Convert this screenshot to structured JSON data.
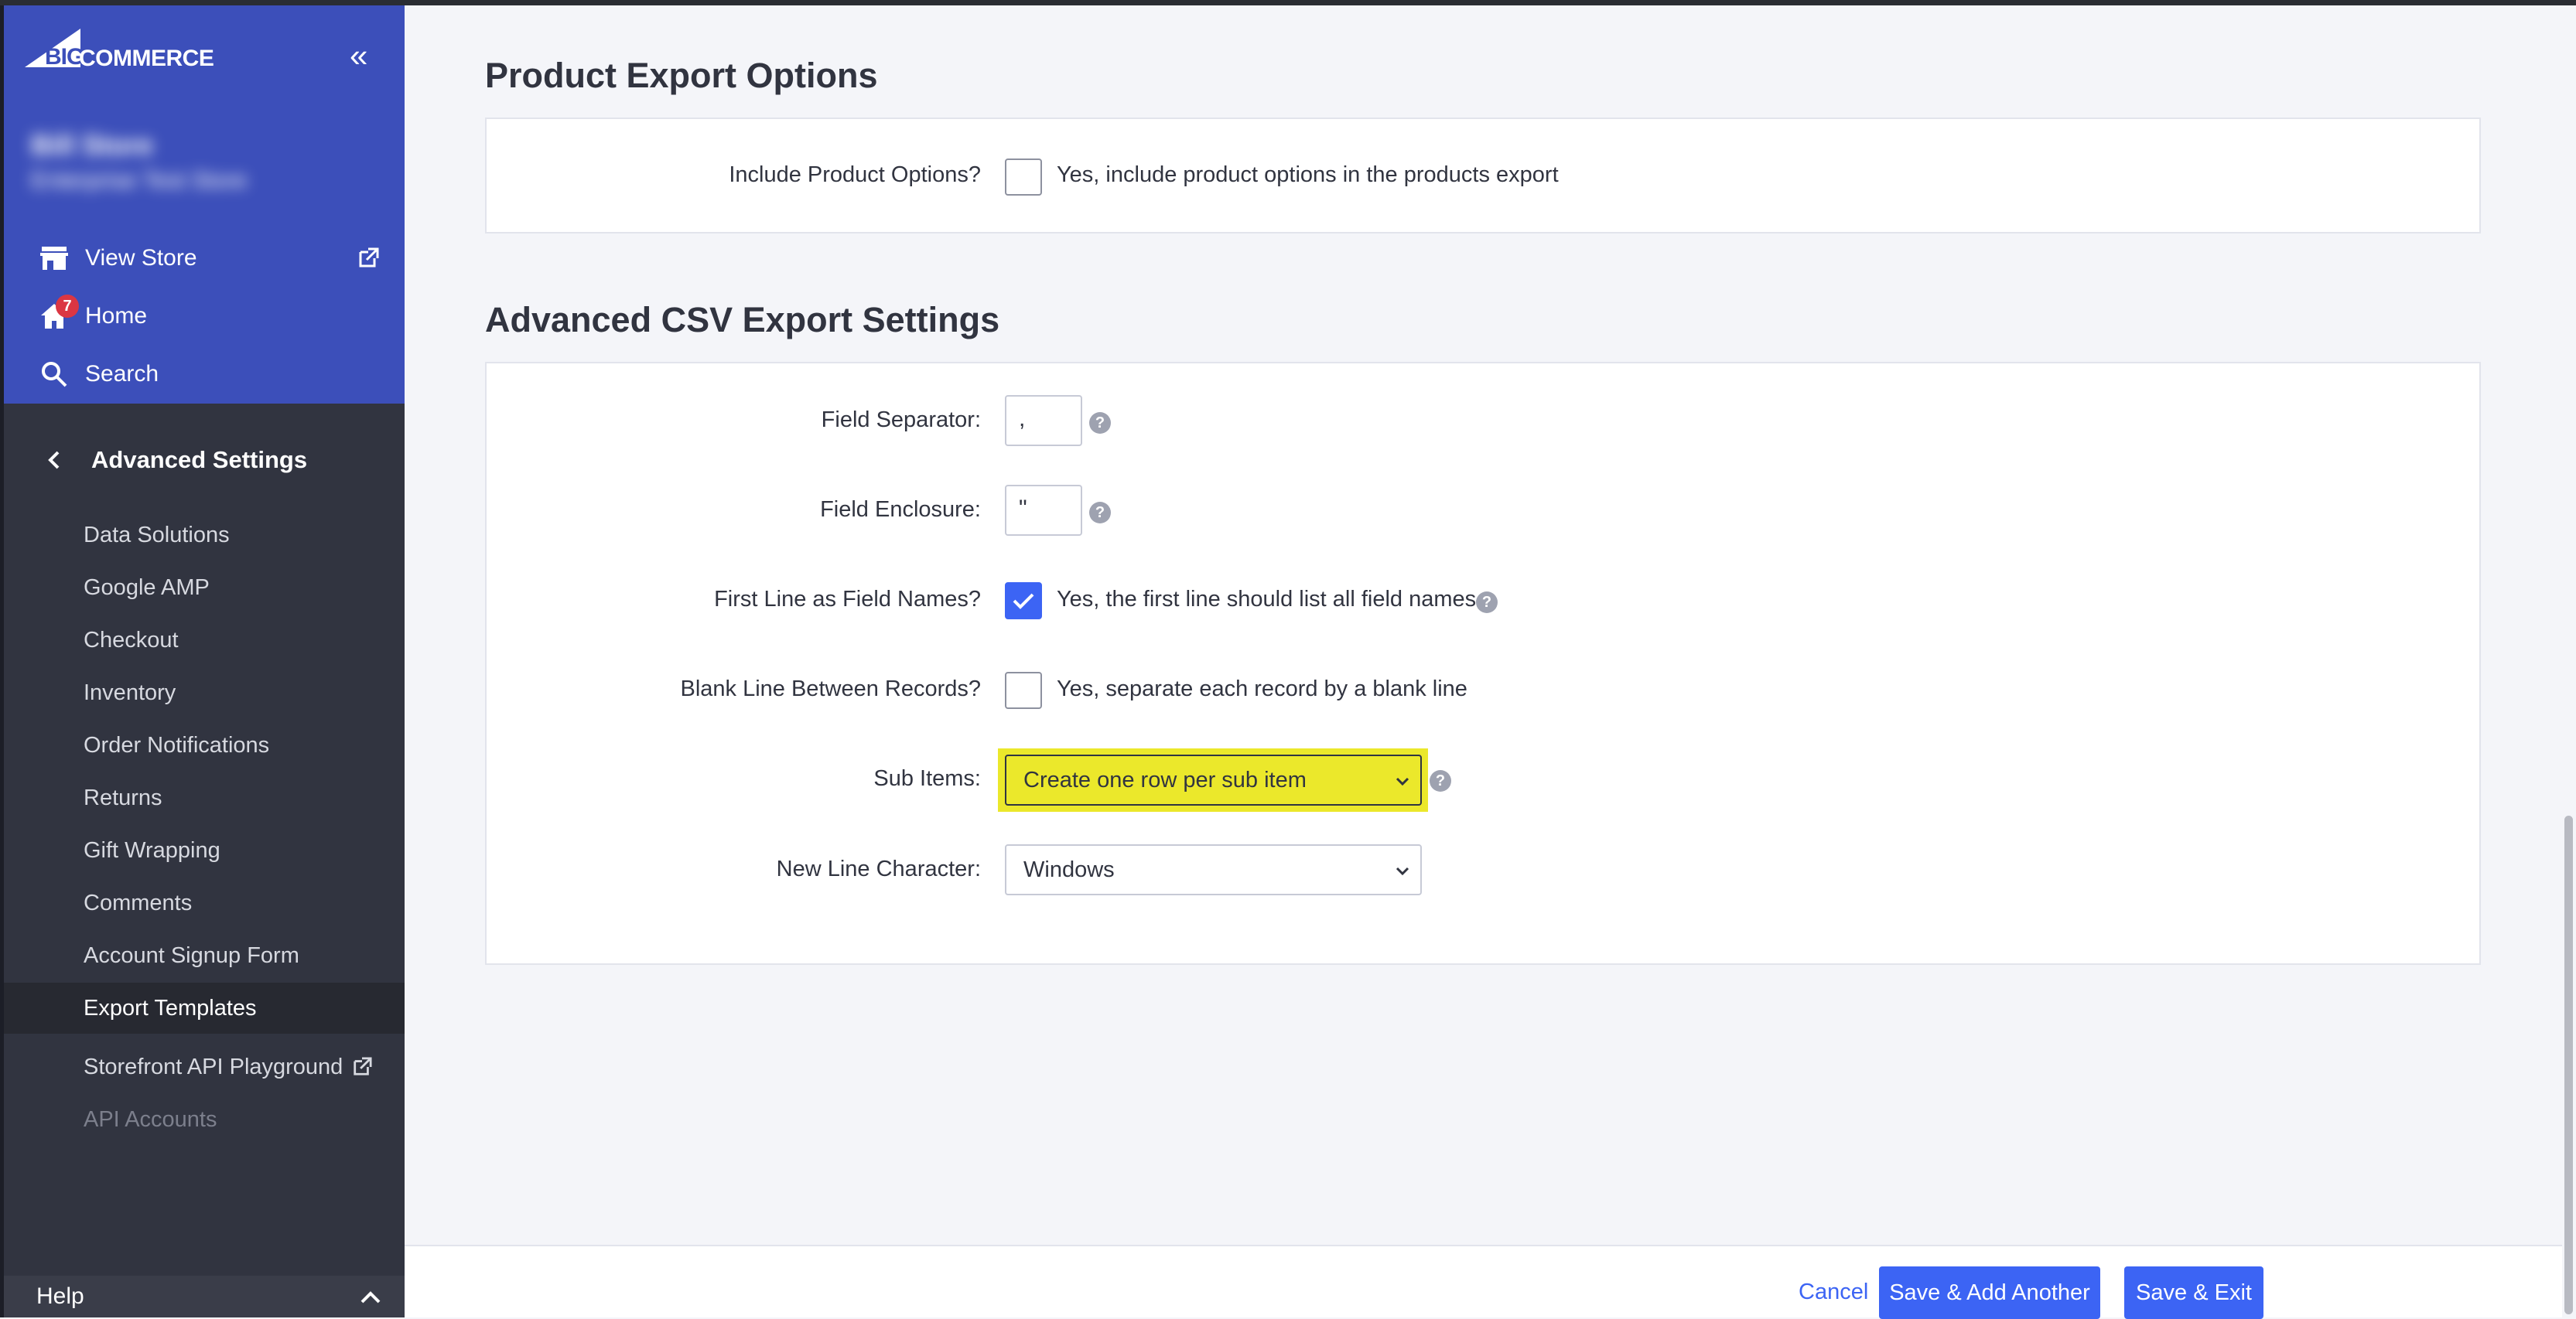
{
  "brand": {
    "logo_big": "BIG",
    "logo_commerce": "COMMERCE"
  },
  "account": {
    "store_name": "Bill Store",
    "store_subtitle": "Enterprise Test Store"
  },
  "sidebar": {
    "top_items": [
      {
        "label": "View Store"
      },
      {
        "label": "Home",
        "badge": "7"
      },
      {
        "label": "Search"
      }
    ],
    "section_title": "Advanced Settings",
    "sub_items": [
      {
        "label": "Data Solutions"
      },
      {
        "label": "Google AMP"
      },
      {
        "label": "Checkout"
      },
      {
        "label": "Inventory"
      },
      {
        "label": "Order Notifications"
      },
      {
        "label": "Returns"
      },
      {
        "label": "Gift Wrapping"
      },
      {
        "label": "Comments"
      },
      {
        "label": "Account Signup Form"
      },
      {
        "label": "Export Templates",
        "active": true
      },
      {
        "label": "Storefront API Playground",
        "external": true
      },
      {
        "label": "API Accounts",
        "disabled": true
      }
    ],
    "help_label": "Help"
  },
  "product_export": {
    "heading": "Product Export Options",
    "include_options_label": "Include Product Options?",
    "include_options_text": "Yes, include product options in the products export",
    "include_options_checked": false
  },
  "csv_settings": {
    "heading": "Advanced CSV Export Settings",
    "field_separator_label": "Field Separator:",
    "field_separator_value": ",",
    "field_enclosure_label": "Field Enclosure:",
    "field_enclosure_value": "\"",
    "first_line_label": "First Line as Field Names?",
    "first_line_text": "Yes, the first line should list all field names",
    "first_line_checked": true,
    "blank_line_label": "Blank Line Between Records?",
    "blank_line_text": "Yes, separate each record by a blank line",
    "blank_line_checked": false,
    "sub_items_label": "Sub Items:",
    "sub_items_value": "Create one row per sub item",
    "new_line_label": "New Line Character:",
    "new_line_value": "Windows"
  },
  "footer": {
    "cancel": "Cancel",
    "save_add_another": "Save & Add Another",
    "save_exit": "Save & Exit"
  },
  "colors": {
    "accent": "#3c64f4",
    "sidebar_blue": "#3c4fba",
    "sidebar_dark": "#313440",
    "highlight": "#ebe82b"
  }
}
